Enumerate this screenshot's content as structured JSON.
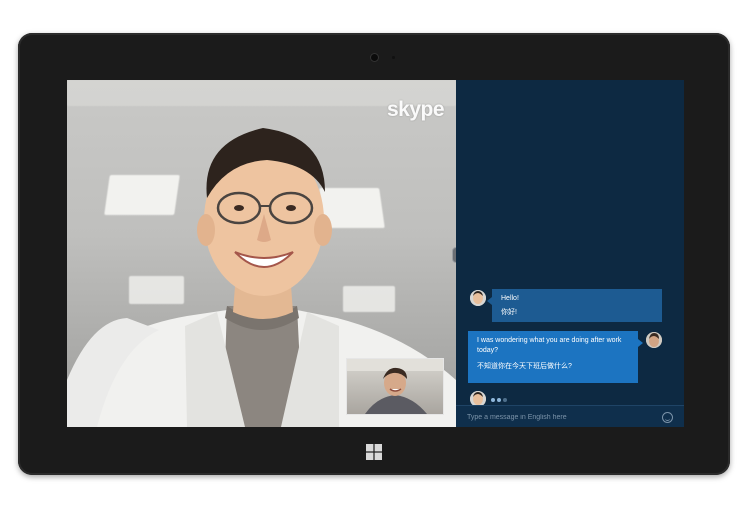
{
  "app": {
    "logo_text": "skype"
  },
  "chat": {
    "messages": [
      {
        "from": "remote",
        "lines": [
          "Hello!",
          "你好!"
        ]
      },
      {
        "from": "local",
        "lines": [
          "I was wondering what you are doing after work",
          "today?",
          "不知道你在今天下班后做什么?"
        ]
      }
    ],
    "typing_indicator": true,
    "input": {
      "placeholder": "Type a message in English here"
    }
  },
  "icons": [
    "windows-logo-icon",
    "emoji-icon",
    "camera-icon"
  ],
  "colors": {
    "chat_background": "#0d2942",
    "incoming_bubble": "#1d5b92",
    "outgoing_bubble": "#1c74c1",
    "tablet_frame": "#1b1b1b"
  }
}
